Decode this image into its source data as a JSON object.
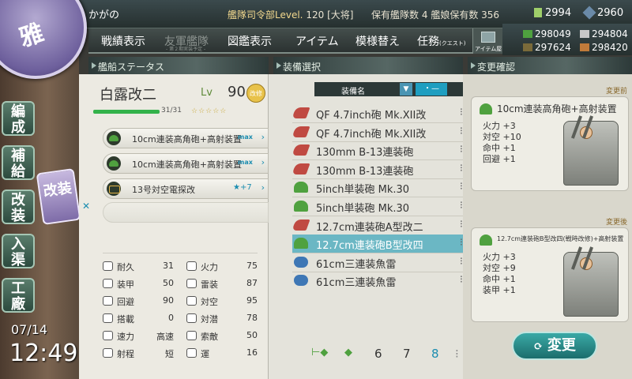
{
  "header": {
    "player_name": "かがの",
    "hq_label": "艦隊司令部Level.",
    "hq_level": "120",
    "rank": "[大将]",
    "fleet_count_label": "保有艦隊数",
    "fleet_count": "4",
    "ship_count_label": "艦娘保有数",
    "ship_count": "356",
    "bucket": "2994",
    "dev_material": "2960"
  },
  "materials": {
    "fuel": "298049",
    "steel": "294804",
    "ammo": "297624",
    "bauxite": "298420"
  },
  "emblem_text": "雅",
  "nav": {
    "items": [
      "戦績表示",
      "友軍艦隊",
      "図鑑表示",
      "アイテム",
      "模様替え",
      "任務"
    ],
    "friend_sub": "- 第２期実装予定 -",
    "quest_sub": "(クエスト)",
    "item_shop": "アイテム屋"
  },
  "sections": {
    "ship_status": "艦船ステータス",
    "equip_select": "装備選択",
    "confirm": "変更確認"
  },
  "side_menu": {
    "items": [
      {
        "char": "編",
        "char2": "成"
      },
      {
        "char": "補",
        "char2": "給"
      },
      {
        "char": "改",
        "char2": "装"
      },
      {
        "char": "入",
        "char2": "渠"
      },
      {
        "char": "工",
        "char2": "廠"
      }
    ],
    "kaisou": "改装"
  },
  "clock": {
    "date": "07/14",
    "time": "12:49"
  },
  "ship": {
    "name": "白露改二",
    "lv_label": "Lv",
    "level": "90",
    "kai_badge": "改修",
    "hp_text": "31/31",
    "stars": "☆☆☆☆☆",
    "hp_fraction": 1.0,
    "slots": [
      {
        "name": "10cm連装高角砲+高射装置",
        "tag": "max"
      },
      {
        "name": "10cm連装高角砲+高射装置",
        "tag": "max"
      },
      {
        "name": "13号対空電探改",
        "tag": "★+7"
      }
    ],
    "stats": [
      {
        "label": "耐久",
        "value": "31"
      },
      {
        "label": "火力",
        "value": "75"
      },
      {
        "label": "装甲",
        "value": "50"
      },
      {
        "label": "雷装",
        "value": "87"
      },
      {
        "label": "回避",
        "value": "90"
      },
      {
        "label": "対空",
        "value": "95"
      },
      {
        "label": "搭載",
        "value": "0"
      },
      {
        "label": "対潜",
        "value": "78"
      },
      {
        "label": "速力",
        "value": "高速"
      },
      {
        "label": "索敵",
        "value": "50"
      },
      {
        "label": "射程",
        "value": "短"
      },
      {
        "label": "運",
        "value": "16"
      }
    ]
  },
  "equip_list": {
    "header_label": "装備名",
    "dash": "・—",
    "items": [
      {
        "name": "QF 4.7inch砲 Mk.XII改",
        "icon": "red"
      },
      {
        "name": "QF 4.7inch砲 Mk.XII改",
        "icon": "red"
      },
      {
        "name": "130mm B-13連装砲",
        "icon": "red"
      },
      {
        "name": "130mm B-13連装砲",
        "icon": "red"
      },
      {
        "name": "5inch単装砲 Mk.30",
        "icon": "green"
      },
      {
        "name": "5inch単装砲 Mk.30",
        "icon": "green"
      },
      {
        "name": "12.7cm連装砲A型改二",
        "icon": "red"
      },
      {
        "name": "12.7cm連装砲B型改四",
        "icon": "green"
      },
      {
        "name": "61cm三連装魚雷",
        "icon": "blue"
      },
      {
        "name": "61cm三連装魚雷",
        "icon": "blue"
      }
    ],
    "pager": [
      "6",
      "7",
      "8"
    ],
    "current_page": "8"
  },
  "confirm": {
    "before_label": "変更前",
    "after_label": "変更後",
    "before": {
      "name": "10cm連装高角砲+高射装置",
      "stats": [
        "火力 +3",
        "対空 +10",
        "命中 +1",
        "回避 +1"
      ]
    },
    "after": {
      "name": "12.7cm連装砲B型改四(戦時改修)+高射装置",
      "stats": [
        "火力 +3",
        "対空 +9",
        "命中 +1",
        "装甲 +1"
      ]
    },
    "button": "変更"
  }
}
